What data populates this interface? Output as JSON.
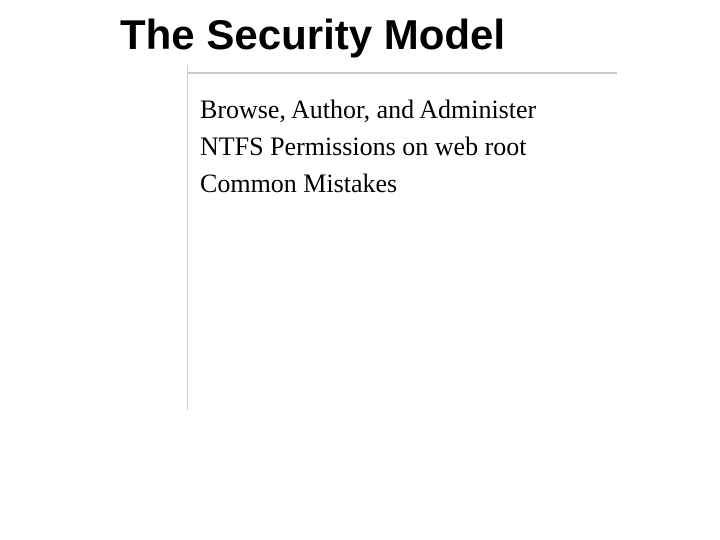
{
  "title": "The Security Model",
  "bullets": [
    "Browse, Author, and Administer",
    "NTFS Permissions on web root",
    "Common Mistakes"
  ]
}
